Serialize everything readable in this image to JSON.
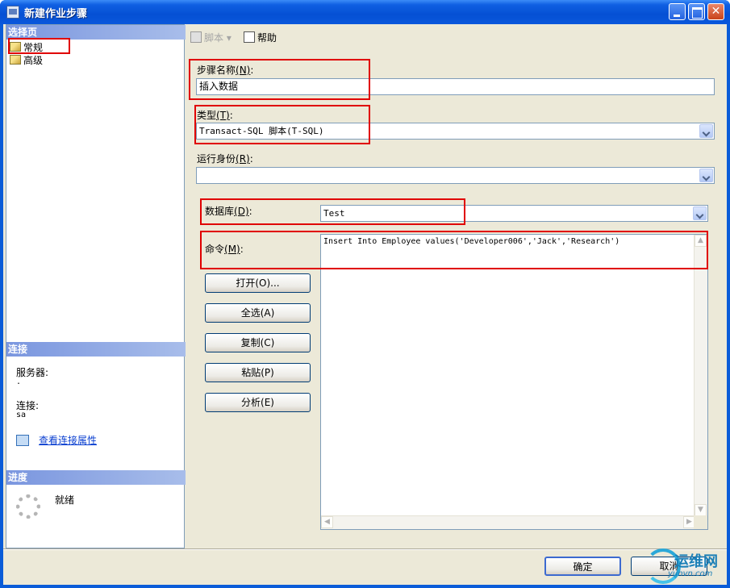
{
  "window": {
    "title": "新建作业步骤"
  },
  "left_pane": {
    "select_page_header": "选择页",
    "pages": [
      {
        "label": "常规"
      },
      {
        "label": "高级"
      }
    ],
    "connection_header": "连接",
    "server_label": "服务器:",
    "server_value": ".",
    "connection_label": "连接:",
    "connection_value": "sa",
    "view_connection_properties": "查看连接属性",
    "progress_header": "进度",
    "progress_status": "就绪"
  },
  "toolbar": {
    "script_label": "脚本",
    "help_label": "帮助"
  },
  "form": {
    "step_name_label": "步骤名称",
    "step_name_key": "(N)",
    "step_name_value": "插入数据",
    "type_label": "类型",
    "type_key": "(T)",
    "type_value": "Transact-SQL 脚本(T-SQL)",
    "run_as_label": "运行身份",
    "run_as_key": "(R)",
    "run_as_value": "",
    "database_label": "数据库",
    "database_key": "(D)",
    "database_value": "Test",
    "command_label": "命令",
    "command_key": "(M)",
    "command_value": "Insert Into Employee values('Developer006','Jack','Research')"
  },
  "actions": {
    "open": "打开(O)...",
    "select_all": "全选(A)",
    "copy": "复制(C)",
    "paste": "粘贴(P)",
    "parse": "分析(E)"
  },
  "dialog_buttons": {
    "ok": "确定",
    "cancel": "取消"
  },
  "watermark": {
    "title": "运维网",
    "site": "yunvn.com"
  },
  "colors": {
    "titlebar": "#0550d4",
    "highlight_box": "#e00000",
    "section_header": "#7a96df",
    "link": "#0a3fd0"
  },
  "icons": [
    "app-icon",
    "page-icon",
    "script-icon",
    "help-icon",
    "connection-properties-icon",
    "progress-spinner-icon"
  ]
}
